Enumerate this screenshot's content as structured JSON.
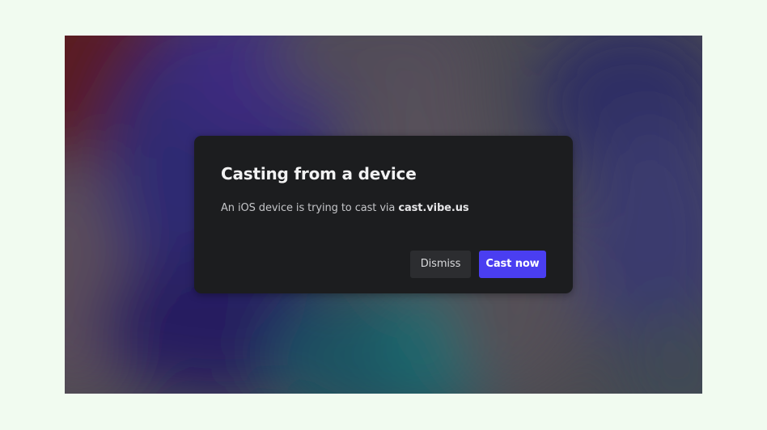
{
  "dialog": {
    "title": "Casting from a device",
    "message_prefix": "An iOS device is trying to cast via",
    "message_host": "cast.vibe.us",
    "dismiss_label": "Dismiss",
    "cast_label": "Cast now"
  },
  "colors": {
    "page_background": "#f1fbf0",
    "dialog_background": "#1c1d1f",
    "primary_button": "#4a3ef1",
    "secondary_button": "#2c2d30"
  }
}
